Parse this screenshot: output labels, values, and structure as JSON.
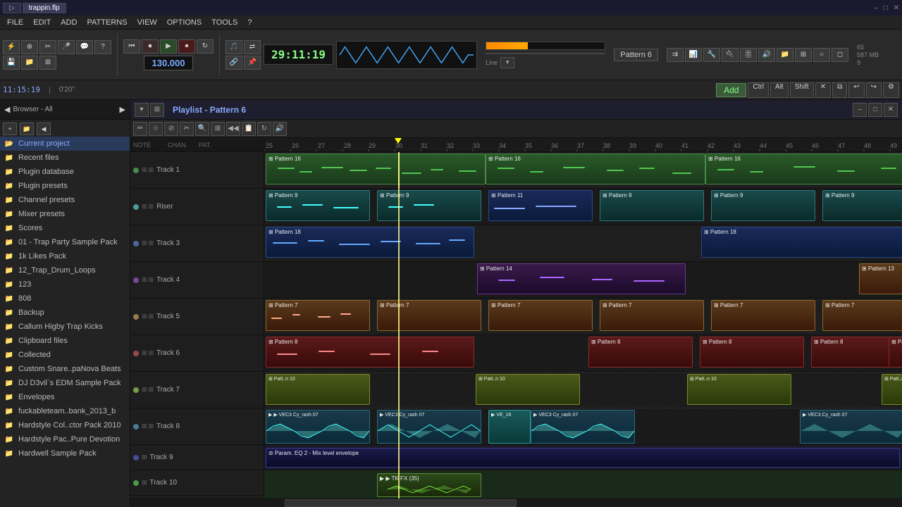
{
  "titleBar": {
    "tabs": [
      {
        "label": "▷",
        "active": false
      },
      {
        "label": "trappin.flp",
        "active": true
      }
    ],
    "title": "trappin.flp"
  },
  "menuBar": {
    "items": [
      "FILE",
      "EDIT",
      "ADD",
      "PATTERNS",
      "VIEW",
      "OPTIONS",
      "TOOLS",
      "?"
    ]
  },
  "toolbar": {
    "timeDisplay": "29:11:19",
    "bpm": "130.000",
    "line": "Line",
    "patternSelector": "Pattern 6",
    "timeCode": "11:15:19",
    "position": "0'20\""
  },
  "playlist": {
    "title": "Playlist - Pattern 6"
  },
  "sidebar": {
    "browserLabel": "Browser - All",
    "items": [
      {
        "label": "Current project",
        "type": "folder-open",
        "highlight": true
      },
      {
        "label": "Recent files",
        "type": "folder"
      },
      {
        "label": "Plugin database",
        "type": "folder"
      },
      {
        "label": "Plugin presets",
        "type": "folder"
      },
      {
        "label": "Channel presets",
        "type": "folder"
      },
      {
        "label": "Mixer presets",
        "type": "folder"
      },
      {
        "label": "Scores",
        "type": "folder"
      },
      {
        "label": "01 - Trap Party Sample Pack",
        "type": "folder"
      },
      {
        "label": "1k Likes Pack",
        "type": "folder"
      },
      {
        "label": "12_Trap_Drum_Loops",
        "type": "folder"
      },
      {
        "label": "123",
        "type": "folder"
      },
      {
        "label": "808",
        "type": "folder"
      },
      {
        "label": "Backup",
        "type": "folder"
      },
      {
        "label": "Callum Higby Trap Kicks",
        "type": "folder"
      },
      {
        "label": "Clipboard files",
        "type": "folder"
      },
      {
        "label": "Collected",
        "type": "folder"
      },
      {
        "label": "Custom Snare..paNova Beats",
        "type": "folder"
      },
      {
        "label": "DJ D3vil's EDM Sample Pack",
        "type": "folder"
      },
      {
        "label": "Envelopes",
        "type": "folder"
      },
      {
        "label": "fuckableteam..bank_2013_b",
        "type": "folder"
      },
      {
        "label": "Hardstyle Col..ctor Pack 2010",
        "type": "folder"
      },
      {
        "label": "Hardstyle Pac..Pure Devotion",
        "type": "folder"
      },
      {
        "label": "Hardwell Sample Pack",
        "type": "folder"
      }
    ]
  },
  "tracks": [
    {
      "name": "Track 1",
      "color": "green"
    },
    {
      "name": "Riser",
      "color": "teal"
    },
    {
      "name": "Track 3",
      "color": "blue"
    },
    {
      "name": "Track 4",
      "color": "purple"
    },
    {
      "name": "Track 5",
      "color": "orange"
    },
    {
      "name": "Track 6",
      "color": "red"
    },
    {
      "name": "Track 7",
      "color": "yellow-green"
    },
    {
      "name": "Track 8",
      "color": "audio"
    },
    {
      "name": "Track 9",
      "color": "param"
    },
    {
      "name": "Track 10",
      "color": "fx"
    }
  ],
  "ruler": {
    "marks": [
      25,
      26,
      27,
      28,
      29,
      30,
      31,
      32,
      33,
      34,
      35,
      36,
      37,
      38,
      39,
      40,
      41,
      42,
      43,
      44,
      45,
      46,
      47,
      48,
      49
    ]
  }
}
